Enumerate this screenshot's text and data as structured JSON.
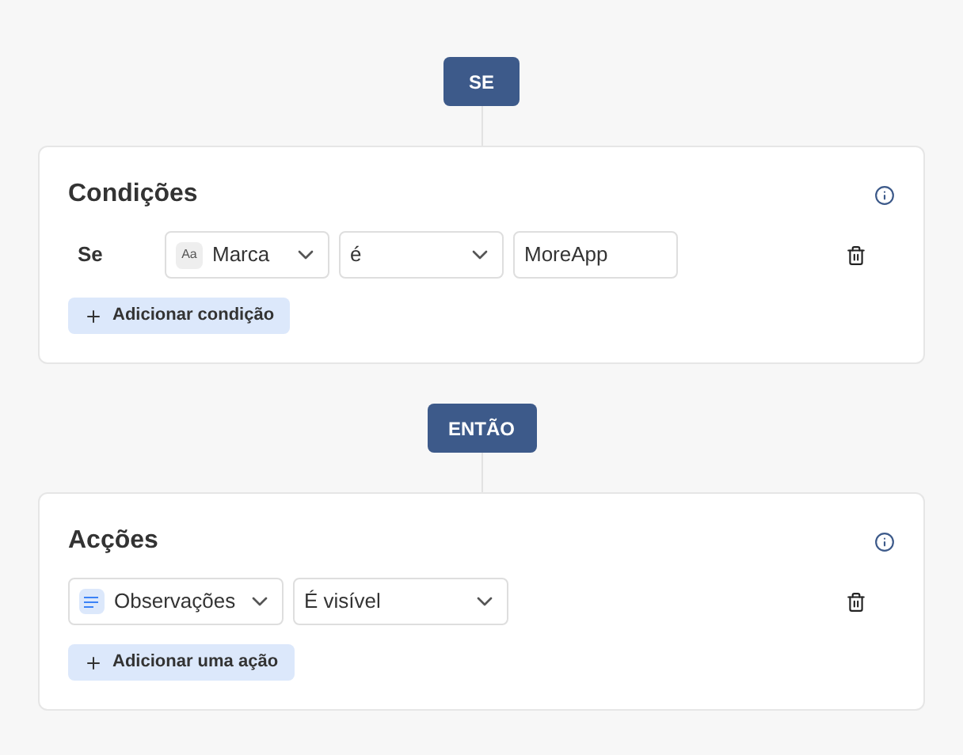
{
  "if_button": {
    "label": "SE"
  },
  "conditions": {
    "title": "Condições",
    "rows": [
      {
        "prefix": "Se",
        "field": {
          "badge": "Aa",
          "value": "Marca"
        },
        "operator": {
          "value": "é"
        },
        "input": {
          "value": "MoreApp"
        }
      }
    ],
    "add_button": {
      "label": "Adicionar condição"
    }
  },
  "then_button": {
    "label": "ENTÃO"
  },
  "actions": {
    "title": "Acções",
    "rows": [
      {
        "field": {
          "value": "Observações"
        },
        "action": {
          "value": "É visível"
        }
      }
    ],
    "add_button": {
      "label": "Adicionar uma ação"
    }
  }
}
